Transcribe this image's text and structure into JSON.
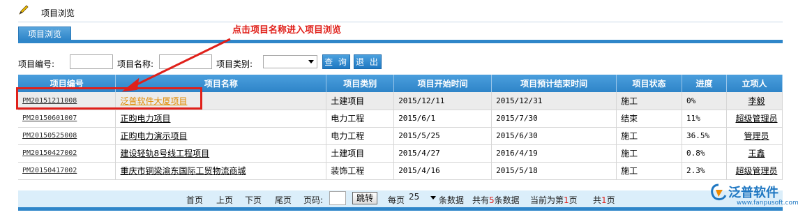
{
  "page": {
    "title": "项目浏览"
  },
  "tab": {
    "label": "项目浏览"
  },
  "annotation": {
    "text": "点击项目名称进入项目浏览"
  },
  "search": {
    "code_label": "项目编号:",
    "name_label": "项目名称:",
    "type_label": "项目类别:",
    "query_button": "查 询",
    "exit_button": "退 出"
  },
  "table": {
    "headers": [
      "项目编号",
      "项目名称",
      "项目类别",
      "项目开始时间",
      "项目预计结束时间",
      "项目状态",
      "进度",
      "立项人"
    ],
    "rows": [
      {
        "code": "PM20151211008",
        "name": "泛普软件大厦项目",
        "type": "土建项目",
        "start": "2015/12/11",
        "end": "2015/12/31",
        "status": "施工",
        "progress": "0%",
        "owner": "李毅"
      },
      {
        "code": "PM20150601007",
        "name": "正昀电力项目",
        "type": "电力工程",
        "start": "2015/6/1",
        "end": "2015/7/30",
        "status": "结束",
        "progress": "11%",
        "owner": "超级管理员"
      },
      {
        "code": "PM20150525008",
        "name": "正昀电力演示项目",
        "type": "电力工程",
        "start": "2015/5/25",
        "end": "2015/6/30",
        "status": "施工",
        "progress": "36.5%",
        "owner": "管理员"
      },
      {
        "code": "PM20150427002",
        "name": "建设轻轨8号线工程项目",
        "type": "土建项目",
        "start": "2015/4/27",
        "end": "2016/4/19",
        "status": "施工",
        "progress": "0.8%",
        "owner": "王鑫"
      },
      {
        "code": "PM20150417002",
        "name": "重庆市铜梁渝东国际工贸物流商城",
        "type": "装饰工程",
        "start": "2015/4/16",
        "end": "2015/5/18",
        "status": "施工",
        "progress": "2.3%",
        "owner": "超级管理员"
      }
    ]
  },
  "pager": {
    "first": "首页",
    "prev": "上页",
    "next": "下页",
    "last": "尾页",
    "page_label": "页码:",
    "jump": "跳转",
    "per_page_prefix": "每页",
    "per_page_value": "25",
    "per_page_suffix": "条数据",
    "total_prefix": "共有",
    "total_count": "5",
    "total_suffix": "条数据",
    "current_prefix": "当前为第",
    "current_page": "1",
    "current_suffix": "页",
    "pages_prefix": "共",
    "pages_count": "1",
    "pages_suffix": "页"
  },
  "logo": {
    "name": "泛普软件",
    "url": "www.fanpusoft.com"
  },
  "colors": {
    "accent": "#2f86c9",
    "annotation": "#e0201a",
    "link_orange": "#e08a00"
  }
}
